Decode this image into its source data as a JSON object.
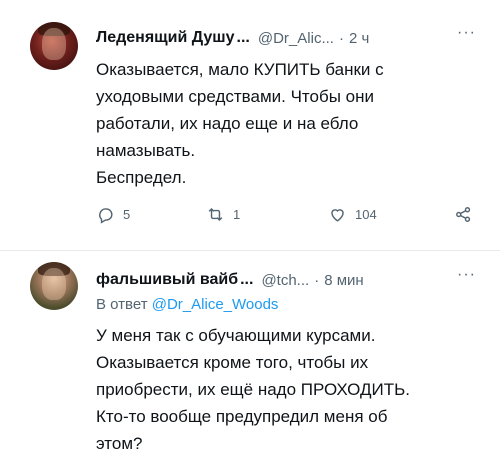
{
  "tweets": [
    {
      "name": "Леденящий Душу",
      "ellipsis": "...",
      "handle": "@Dr_Alic...",
      "dot": "·",
      "time": "2 ч",
      "more": "···",
      "text_lines": [
        "Оказывается, мало КУПИТЬ банки с",
        "уходовыми средствами. Чтобы они",
        "работали, их надо еще и на ебло",
        "намазывать.",
        "Беспредел."
      ],
      "actions": {
        "replies": "5",
        "retweets": "1",
        "likes": "104"
      },
      "icons": [
        "reply-icon",
        "retweet-icon",
        "like-icon",
        "share-icon"
      ]
    },
    {
      "name": "фальшивый вайб",
      "ellipsis": "...",
      "handle": "@tch...",
      "dot": "·",
      "time": "8 мин",
      "more": "···",
      "reply_prefix": "В ответ",
      "reply_mention": "@Dr_Alice_Woods",
      "text_lines": [
        "У меня так с обучающими курсами.",
        "Оказывается кроме того, чтобы их",
        "приобрести, их ещё надо ПРОХОДИТЬ.",
        "Кто-то вообще предупредил меня об",
        "этом?"
      ]
    }
  ],
  "colors": {
    "text": "#0f1419",
    "muted": "#536471",
    "link": "#1d9bf0",
    "divider": "#e7e9ea"
  }
}
